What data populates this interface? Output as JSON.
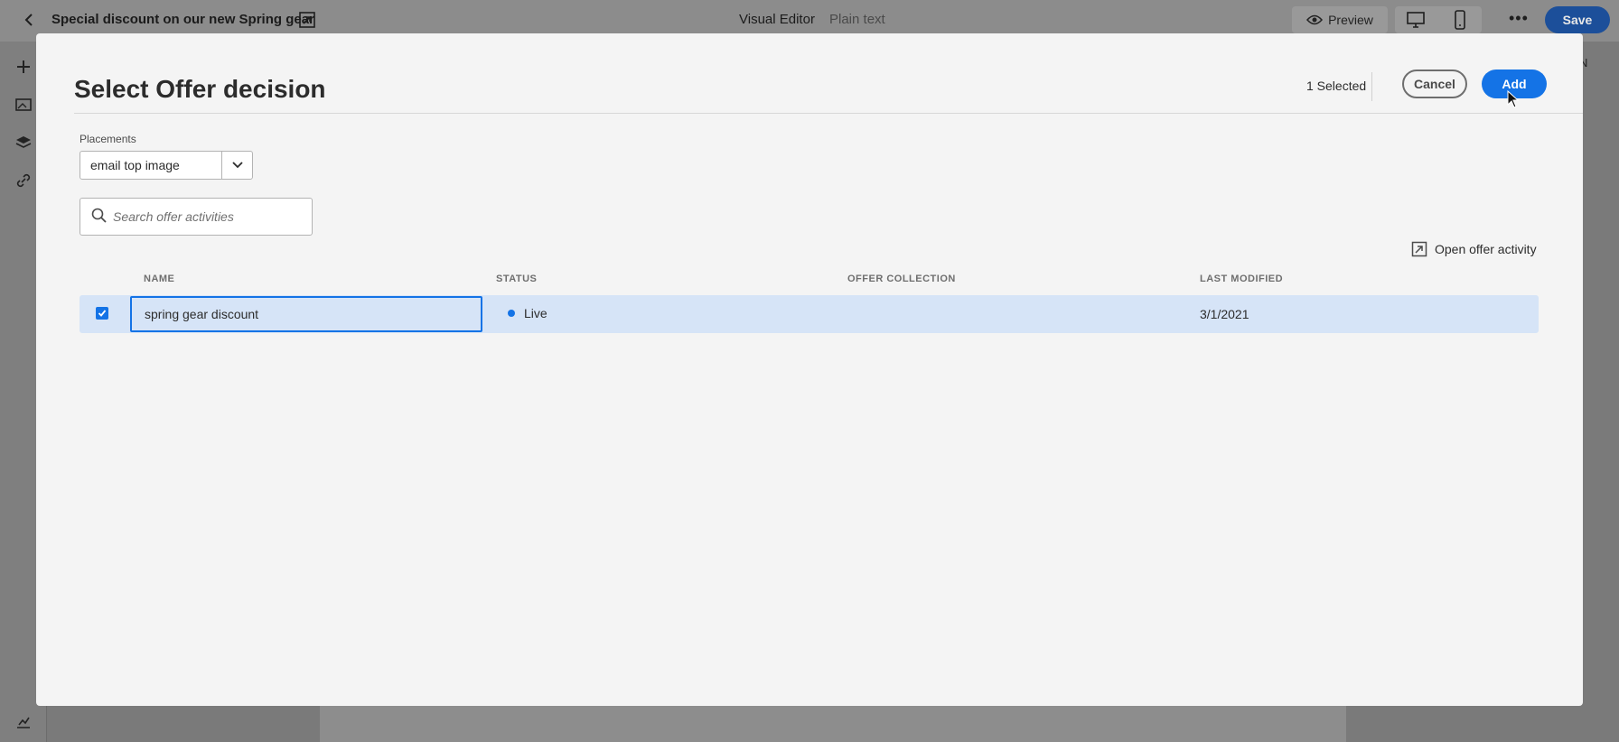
{
  "app": {
    "document_title": "Special discount on our new Spring gear",
    "modes": [
      "Visual Editor",
      "Plain text"
    ],
    "preview_label": "Preview",
    "save_label": "Save",
    "right_panel_letter": "N"
  },
  "modal": {
    "title": "Select Offer decision",
    "selected_count": "1 Selected",
    "cancel_label": "Cancel",
    "add_label": "Add",
    "placements": {
      "label": "Placements",
      "value": "email top image"
    },
    "search": {
      "placeholder": "Search offer activities"
    },
    "open_activity_label": "Open offer activity",
    "table": {
      "headers": [
        "NAME",
        "STATUS",
        "OFFER COLLECTION",
        "LAST MODIFIED"
      ],
      "rows": [
        {
          "selected": true,
          "name": "spring gear discount",
          "status": "Live",
          "offer_collection": "",
          "last_modified": "3/1/2021"
        }
      ]
    }
  },
  "colors": {
    "accent": "#1473e6",
    "row_selected_bg": "#d6e4f7",
    "modal_bg": "#f4f4f4"
  },
  "icons": [
    "chevron-left-icon",
    "open-in-icon",
    "eye-icon",
    "desktop-icon",
    "mobile-icon",
    "more-icon",
    "plus-icon",
    "image-icon",
    "layers-icon",
    "link-icon",
    "history-icon",
    "chevron-down-icon",
    "search-icon",
    "checkmark-icon",
    "cursor-icon"
  ]
}
